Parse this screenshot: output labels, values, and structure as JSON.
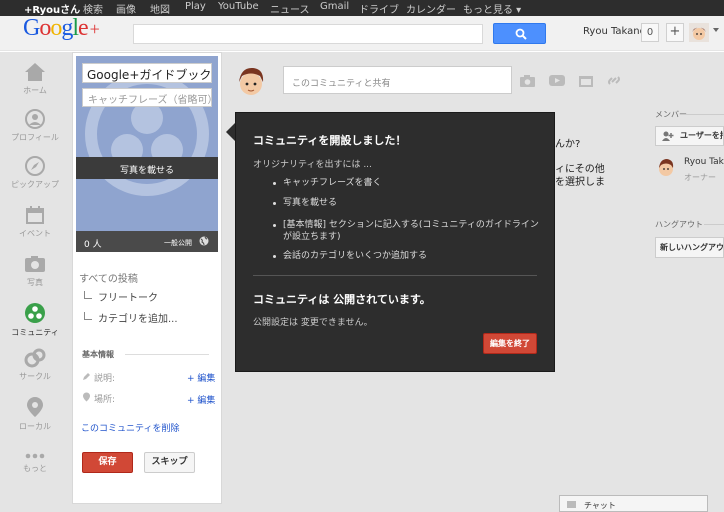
{
  "topbar": {
    "links": [
      "+Ryouさん",
      "検索",
      "画像",
      "地図",
      "Play",
      "YouTube",
      "ニュース",
      "Gmail",
      "ドライブ",
      "カレンダー",
      "もっと見る ▾"
    ]
  },
  "header": {
    "logo": "Google+",
    "user_name": "Ryou Takano",
    "notifications": "0",
    "share_plus": "+"
  },
  "nav": {
    "items": [
      {
        "label": "ホーム",
        "icon": "home-icon"
      },
      {
        "label": "プロフィール",
        "icon": "profile-icon"
      },
      {
        "label": "ピックアップ",
        "icon": "explore-icon"
      },
      {
        "label": "イベント",
        "icon": "events-icon"
      },
      {
        "label": "写真",
        "icon": "photos-icon"
      },
      {
        "label": "コミュニティ",
        "icon": "communities-icon"
      },
      {
        "label": "サークル",
        "icon": "circles-icon"
      },
      {
        "label": "ローカル",
        "icon": "local-icon"
      },
      {
        "label": "もっと",
        "icon": "more-icon"
      }
    ]
  },
  "community": {
    "name_value": "Google+ガイドブックの",
    "tagline_placeholder": "キャッチフレーズ（省略可）",
    "photo_label": "写真を載せる",
    "member_count": "0 人",
    "visibility": "一般公開",
    "all_posts": "すべての投稿",
    "categories": [
      "フリートーク",
      "カテゴリを追加..."
    ],
    "basic_info": "基本情報",
    "description_label": "説明:",
    "location_label": "場所:",
    "edit_label": "+ 編集",
    "delete_link": "このコミュニティを削除",
    "save": "保存",
    "skip": "スキップ"
  },
  "share": {
    "placeholder": "このコミュニティと共有"
  },
  "background": {
    "line1": "んか?",
    "line2": "ィにその他",
    "line3": "を選択しま"
  },
  "sidebar": {
    "members_label": "メンバー",
    "invite_label": "ユーザーを招",
    "member_name": "Ryou Takan",
    "member_role": "オーナー",
    "hangout_label": "ハングアウト",
    "hangout_button": "新しいハングアウ"
  },
  "chat": {
    "label": "チャット"
  },
  "dialog": {
    "title": "コミュニティを開設しました！",
    "intro": "オリジナリティを出すには ...",
    "tips": [
      "キャッチフレーズを書く",
      "写真を載せる",
      "[基本情報] セクションに記入する(コミュニティのガイドラインが設立ちます)",
      "会話のカテゴリをいくつか追加する"
    ],
    "public_title": "コミュニティは 公開されています。",
    "public_note": "公開設定は 変更できません。",
    "finish_button": "編集を終了"
  },
  "colors": {
    "accent_blue": "#4d90fe",
    "red_button": "#d14836",
    "dialog_bg": "#2d2d2d",
    "cover_blue": "#8fa4cf"
  }
}
